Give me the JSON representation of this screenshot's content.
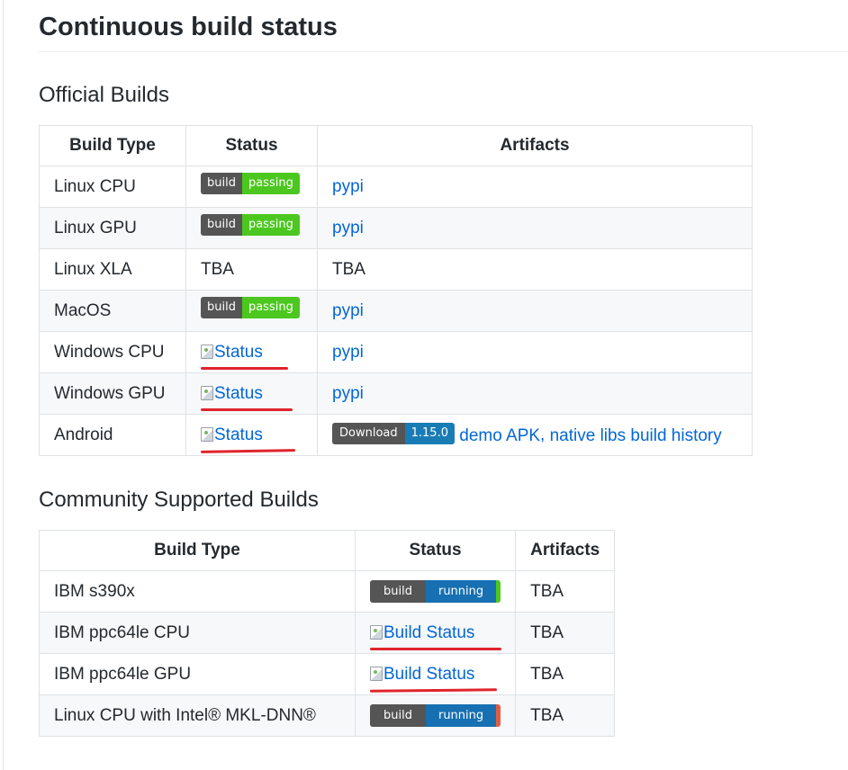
{
  "page_title": "Continuous build status",
  "official": {
    "heading": "Official Builds",
    "columns": [
      "Build Type",
      "Status",
      "Artifacts"
    ],
    "rows": [
      {
        "build_type": "Linux CPU",
        "status_left": "build",
        "status_right": "passing",
        "artifact": "pypi"
      },
      {
        "build_type": "Linux GPU",
        "status_left": "build",
        "status_right": "passing",
        "artifact": "pypi"
      },
      {
        "build_type": "Linux XLA",
        "status": "TBA",
        "artifact": "TBA"
      },
      {
        "build_type": "MacOS",
        "status_left": "build",
        "status_right": "passing",
        "artifact": "pypi"
      },
      {
        "build_type": "Windows CPU",
        "status_alt": "Status",
        "artifact": "pypi"
      },
      {
        "build_type": "Windows GPU",
        "status_alt": "Status",
        "artifact": "pypi"
      },
      {
        "build_type": "Android",
        "status_alt": "Status",
        "download_left": "Download",
        "download_right": "1.15.0",
        "artifact_demo": "demo APK",
        "artifact_sep": ", ",
        "artifact_native": "native libs build history"
      }
    ]
  },
  "community": {
    "heading": "Community Supported Builds",
    "columns": [
      "Build Type",
      "Status",
      "Artifacts"
    ],
    "rows": [
      {
        "build_type": "IBM s390x",
        "status_left": "build",
        "status_right": "running",
        "tip_color": "#4cc71f",
        "artifact": "TBA"
      },
      {
        "build_type": "IBM ppc64le CPU",
        "status_alt": "Build Status",
        "artifact": "TBA"
      },
      {
        "build_type": "IBM ppc64le GPU",
        "status_alt": "Build Status",
        "artifact": "TBA"
      },
      {
        "build_type": "Linux CPU with Intel® MKL-DNN®",
        "status_left": "build",
        "status_right": "running",
        "tip_color": "#e05d44",
        "artifact": "TBA"
      }
    ]
  },
  "colors": {
    "link": "#0366d6",
    "passing": "#4cc71f",
    "running": "#1670b1",
    "annotation": "#e0242c"
  }
}
